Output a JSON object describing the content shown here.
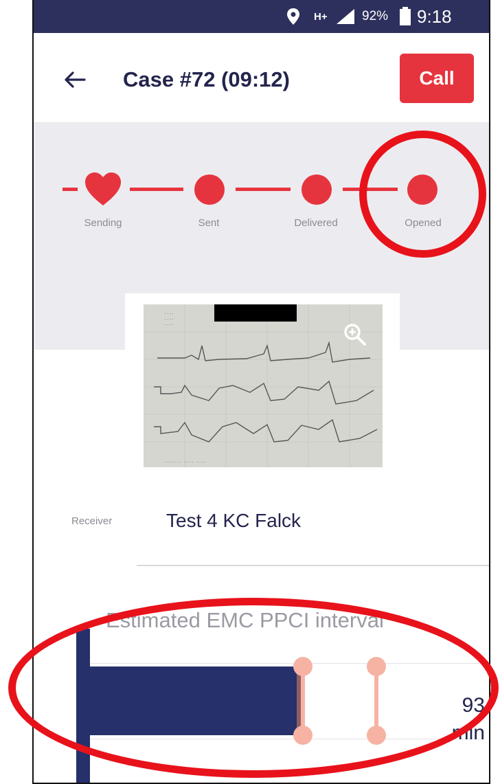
{
  "status_bar": {
    "network": "H+",
    "battery_percent": "92%",
    "time": "9:18"
  },
  "header": {
    "title": "Case #72 (09:12)",
    "call_label": "Call"
  },
  "progress": {
    "steps": [
      {
        "label": "Sending"
      },
      {
        "label": "Sent"
      },
      {
        "label": "Delivered"
      },
      {
        "label": "Opened"
      }
    ],
    "current_step": "Opened"
  },
  "receiver": {
    "label": "Receiver",
    "value": "Test 4 KC Falck"
  },
  "interval": {
    "title": "Estimated EMC PPCI interval",
    "value": "93",
    "unit": "min"
  },
  "colors": {
    "accent": "#e6343e",
    "navy": "#26306b",
    "status_bar": "#2d2f5c",
    "annotation": "#e8121b"
  }
}
